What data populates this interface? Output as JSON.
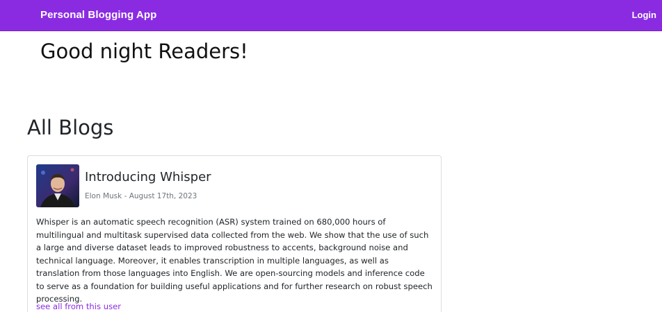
{
  "navbar": {
    "brand": "Personal Blogging App",
    "login_label": "Login",
    "color": "#8a2be2"
  },
  "greeting": "Good night Readers!",
  "section_title": "All Blogs",
  "blogs": [
    {
      "title": "Introducing Whisper",
      "meta": "Elon Musk - August 17th, 2023",
      "body": "Whisper is an automatic speech recognition (ASR) system trained on 680,000 hours of multilingual and multitask supervised data collected from the web. We show that the use of such a large and diverse dataset leads to improved robustness to accents, background noise and technical language. Moreover, it enables transcription in multiple languages, as well as translation from those languages into English. We are open-sourcing models and inference code to serve as a foundation for building useful applications and for further research on robust speech processing.",
      "user_link": "see all from this user",
      "avatar_icon": "author-photo"
    }
  ]
}
